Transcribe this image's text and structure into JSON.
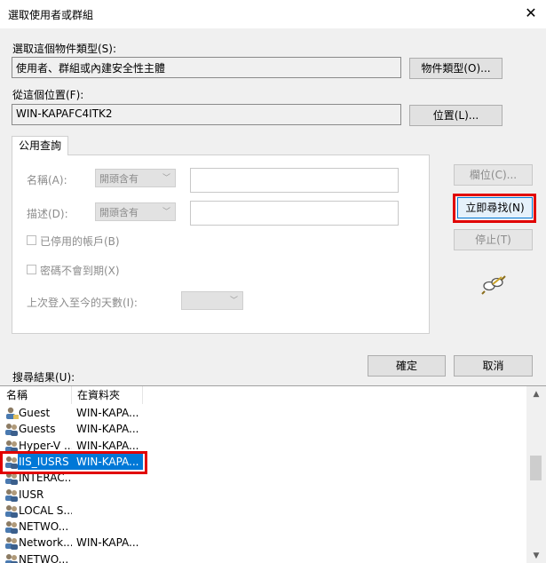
{
  "window": {
    "title": "選取使用者或群組",
    "close_glyph": "✕"
  },
  "object_types": {
    "label": "選取這個物件類型(S):",
    "value": "使用者、群組或內建安全性主體",
    "button": "物件類型(O)..."
  },
  "location": {
    "label": "從這個位置(F):",
    "value": "WIN-KAPAFC4ITK2",
    "button": "位置(L)..."
  },
  "tab": {
    "label": "公用查詢"
  },
  "query": {
    "name_label": "名稱(A):",
    "name_mode": "開頭含有",
    "name_value": "",
    "desc_label": "描述(D):",
    "desc_mode": "開頭含有",
    "desc_value": "",
    "disabled_accounts": "已停用的帳戶(B)",
    "non_expiring_pw": "密碼不會到期(X)",
    "days_since_logon": "上次登入至今的天數(I):",
    "days_value": ""
  },
  "side_buttons": {
    "columns": "欄位(C)...",
    "find_now": "立即尋找(N)",
    "stop": "停止(T)"
  },
  "ok": "確定",
  "cancel": "取消",
  "results": {
    "label": "搜尋結果(U):",
    "headers": {
      "name": "名稱",
      "folder": "在資料夾"
    },
    "rows": [
      {
        "name": "Guest",
        "folder": "WIN-KAPA...",
        "icon": "user-icon"
      },
      {
        "name": "Guests",
        "folder": "WIN-KAPA...",
        "icon": "group-icon"
      },
      {
        "name": "Hyper-V ...",
        "folder": "WIN-KAPA...",
        "icon": "group-icon"
      },
      {
        "name": "IIS_IUSRS",
        "folder": "WIN-KAPA...",
        "icon": "group-icon",
        "selected": true
      },
      {
        "name": "INTERAC...",
        "folder": "",
        "icon": "group-icon"
      },
      {
        "name": "IUSR",
        "folder": "",
        "icon": "group-icon"
      },
      {
        "name": "LOCAL S...",
        "folder": "",
        "icon": "group-icon"
      },
      {
        "name": "NETWO...",
        "folder": "",
        "icon": "group-icon"
      },
      {
        "name": "Network...",
        "folder": "WIN-KAPA...",
        "icon": "group-icon"
      },
      {
        "name": "NETWO...",
        "folder": "",
        "icon": "group-icon"
      }
    ]
  },
  "colors": {
    "highlight": "#0078d7",
    "annotation_red": "#e10000"
  }
}
